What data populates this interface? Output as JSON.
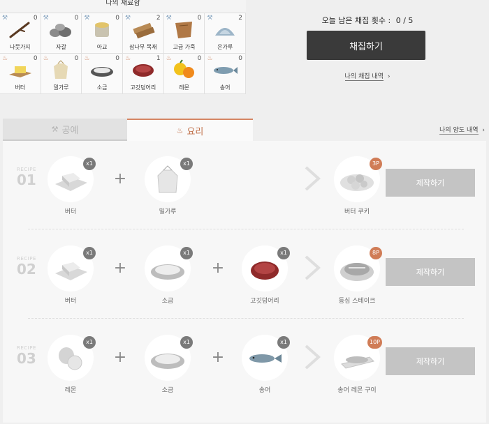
{
  "inventory": {
    "title": "나의 재료함",
    "items": [
      {
        "name": "나뭇가지",
        "count": "0",
        "icon": "branch-icon",
        "tool": true
      },
      {
        "name": "자갈",
        "count": "0",
        "icon": "gravel-icon",
        "tool": true
      },
      {
        "name": "아교",
        "count": "0",
        "icon": "glue-icon",
        "tool": true
      },
      {
        "name": "삼나무 목재",
        "count": "2",
        "icon": "cedar-wood-icon",
        "tool": true
      },
      {
        "name": "고급 가죽",
        "count": "0",
        "icon": "leather-icon",
        "tool": true
      },
      {
        "name": "은가루",
        "count": "2",
        "icon": "silver-powder-icon",
        "tool": true
      },
      {
        "name": "버터",
        "count": "0",
        "icon": "butter-icon",
        "tool": false
      },
      {
        "name": "밀가루",
        "count": "0",
        "icon": "flour-icon",
        "tool": false
      },
      {
        "name": "소금",
        "count": "0",
        "icon": "salt-icon",
        "tool": false
      },
      {
        "name": "고깃덩어리",
        "count": "1",
        "icon": "meat-icon",
        "tool": false
      },
      {
        "name": "레몬",
        "count": "0",
        "icon": "lemon-icon",
        "tool": false
      },
      {
        "name": "송어",
        "count": "0",
        "icon": "trout-icon",
        "tool": false
      }
    ]
  },
  "gather": {
    "remaining_label": "오늘 남은 채집 횟수 :",
    "remaining_value": "0 / 5",
    "button_label": "채집하기",
    "history_label": "나의 채집 내역",
    "history_chevron": "›"
  },
  "tabs": {
    "craft_label": "공예",
    "cook_label": "요리",
    "trade_link": "나의 양도 내역",
    "trade_chevron": "›"
  },
  "recipes": [
    {
      "label": "RECIPE",
      "number": "01",
      "ingredients": [
        {
          "name": "버터",
          "qty": "x1",
          "icon": "butter-icon"
        },
        {
          "name": "밀가루",
          "qty": "x1",
          "icon": "flour-icon"
        }
      ],
      "result": {
        "name": "버터 쿠키",
        "points": "3P",
        "icon": "cookie-icon"
      },
      "button_label": "제작하기"
    },
    {
      "label": "RECIPE",
      "number": "02",
      "ingredients": [
        {
          "name": "버터",
          "qty": "x1",
          "icon": "butter-icon"
        },
        {
          "name": "소금",
          "qty": "x1",
          "icon": "salt-icon"
        },
        {
          "name": "고깃덩어리",
          "qty": "x1",
          "icon": "meat-icon"
        }
      ],
      "result": {
        "name": "등심 스테이크",
        "points": "8P",
        "icon": "steak-icon"
      },
      "button_label": "제작하기"
    },
    {
      "label": "RECIPE",
      "number": "03",
      "ingredients": [
        {
          "name": "레몬",
          "qty": "x1",
          "icon": "lemon-icon"
        },
        {
          "name": "소금",
          "qty": "x1",
          "icon": "salt-icon"
        },
        {
          "name": "송어",
          "qty": "x1",
          "icon": "trout-icon"
        }
      ],
      "result": {
        "name": "송어 레몬 구이",
        "points": "10P",
        "icon": "grilled-trout-icon"
      },
      "button_label": "제작하기"
    }
  ],
  "colors": {
    "accent": "#d58563",
    "gather_button": "#3a3a3a",
    "make_button": "#c4c4c4",
    "point_badge": "#d07c56",
    "qty_badge": "#7a7a7a"
  }
}
